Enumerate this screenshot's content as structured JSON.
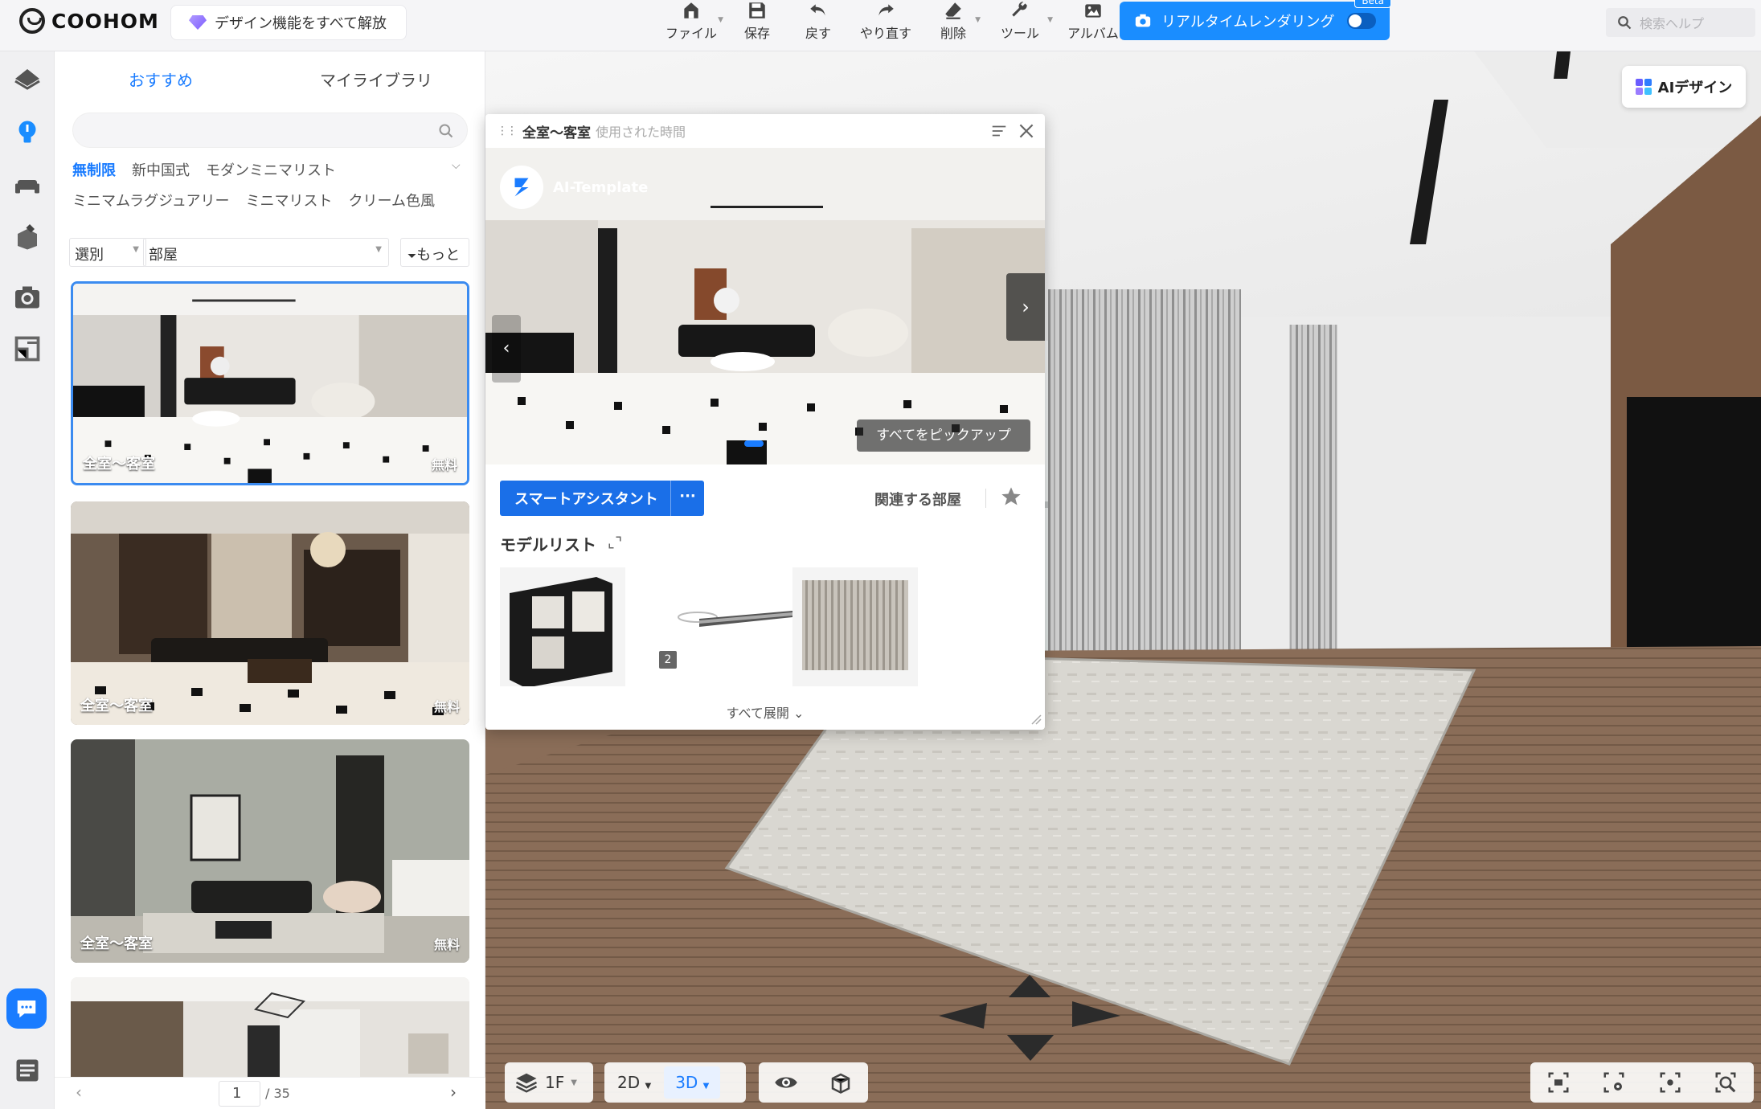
{
  "app": {
    "brand": "COOHOM"
  },
  "header": {
    "unlock_label": "デザイン機能をすべて解放",
    "tools": [
      {
        "label": "ファイル",
        "icon": "file-icon"
      },
      {
        "label": "保存",
        "icon": "save-icon"
      },
      {
        "label": "戻す",
        "icon": "undo-icon"
      },
      {
        "label": "やり直す",
        "icon": "redo-icon"
      },
      {
        "label": "削除",
        "icon": "delete-icon"
      },
      {
        "label": "ツール",
        "icon": "wrench-icon"
      },
      {
        "label": "アルバム",
        "icon": "album-icon"
      }
    ],
    "render_label": "リアルタイムレンダリング",
    "render_badge": "Beta",
    "search_placeholder": "検索ヘルプ"
  },
  "sidebar": {
    "tabs": [
      "おすすめ",
      "マイライブラリ"
    ],
    "active_tab": "おすすめ",
    "search_value": "",
    "style_chips_row1": [
      "無制限",
      "新中国式",
      "モダンミニマリスト"
    ],
    "style_chips_row2": [
      "ミニマムラグジュアリー",
      "ミニマリスト",
      "クリーム色風"
    ],
    "active_chip": "無制限",
    "sort_value": "選別",
    "room_value": "部屋",
    "more_label": "もっと",
    "cards": [
      {
        "name": "全室～客室",
        "price": "無料",
        "selected": true
      },
      {
        "name": "全室～客室",
        "price": "無料",
        "selected": false
      },
      {
        "name": "全室～客室",
        "price": "無料",
        "selected": false
      }
    ],
    "pager": {
      "current": "1",
      "total": "/ 35"
    }
  },
  "viewport": {
    "ai_design_label": "AIデザイン",
    "floor_label": "1F",
    "view_2d": "2D",
    "view_3d": "3D",
    "active_view": "3D"
  },
  "popover": {
    "title": "全室～客室",
    "subtitle": "使用された時間",
    "badge": "AI-Template",
    "pick_all_label": "すべてをピックアップ",
    "smart_assistant_label": "スマートアシスタント",
    "smart_more": "···",
    "related_label": "関連する部屋",
    "model_list_title": "モデルリスト",
    "models": [
      {
        "name": "cabinet",
        "count": ""
      },
      {
        "name": "ceiling-light",
        "count": "2"
      },
      {
        "name": "linear-light",
        "count": ""
      },
      {
        "name": "wall-panel",
        "count": ""
      }
    ],
    "expand_all_label": "すべて展開 ⌄"
  },
  "colors": {
    "accent": "#1a7cff",
    "render_button": "#1a8dff",
    "smart_button": "#1a6fe8"
  }
}
